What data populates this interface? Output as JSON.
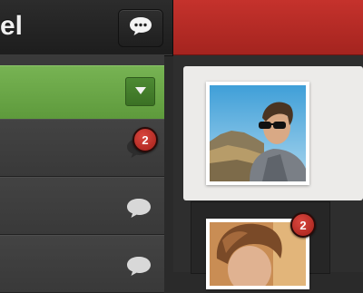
{
  "header": {
    "title": "el",
    "chat_button_icon": "speech-bubble-icon"
  },
  "list": {
    "dropdown_icon": "triangle-down-icon",
    "rows": [
      {
        "comment_icon": "speech-bubble-icon",
        "badge": "2"
      },
      {
        "comment_icon": "speech-bubble-icon",
        "badge": ""
      },
      {
        "comment_icon": "speech-bubble-icon",
        "badge": ""
      }
    ]
  },
  "feed": {
    "cards": [
      {
        "photo": "avatar-man-sunglasses-hoodie",
        "badge": ""
      },
      {
        "photo": "avatar-man-curly-hair",
        "badge": "2"
      }
    ]
  },
  "colors": {
    "accent_red": "#b62c27",
    "accent_green": "#6aa847",
    "badge_red": "#b8302a"
  }
}
